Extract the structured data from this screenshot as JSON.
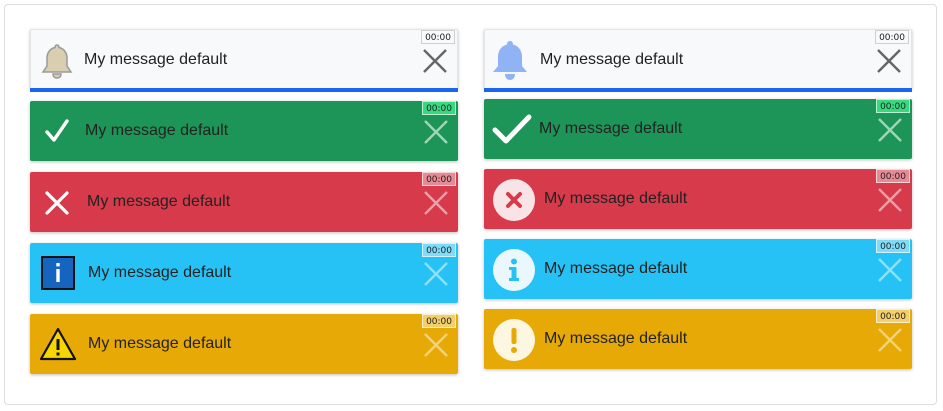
{
  "toasts": {
    "default_message": "My message default",
    "timer": "00:00"
  },
  "colors": {
    "default_bg": "#f8f9fa",
    "progress": "#1a66f2",
    "success": "#1e9558",
    "danger": "#d63a4b",
    "info": "#27c2f5",
    "warning": "#e6a905"
  },
  "left_column": [
    {
      "type": "default",
      "icon": "bell-outline-icon",
      "message": "My message default",
      "timer": "00:00"
    },
    {
      "type": "success",
      "icon": "checkmark-icon",
      "message": "My message default",
      "timer": "00:00"
    },
    {
      "type": "danger",
      "icon": "x-mark-icon",
      "message": "My message default",
      "timer": "00:00"
    },
    {
      "type": "info",
      "icon": "info-box-icon",
      "message": "My message default",
      "timer": "00:00"
    },
    {
      "type": "warning",
      "icon": "warning-triangle-icon",
      "message": "My message default",
      "timer": "00:00"
    }
  ],
  "right_column": [
    {
      "type": "default",
      "icon": "bell-filled-icon",
      "message": "My message default",
      "timer": "00:00"
    },
    {
      "type": "success",
      "icon": "bold-checkmark-icon",
      "message": "My message default",
      "timer": "00:00"
    },
    {
      "type": "danger",
      "icon": "x-circle-icon",
      "message": "My message default",
      "timer": "00:00"
    },
    {
      "type": "info",
      "icon": "info-circle-icon",
      "message": "My message default",
      "timer": "00:00"
    },
    {
      "type": "warning",
      "icon": "exclamation-circle-icon",
      "message": "My message default",
      "timer": "00:00"
    }
  ]
}
